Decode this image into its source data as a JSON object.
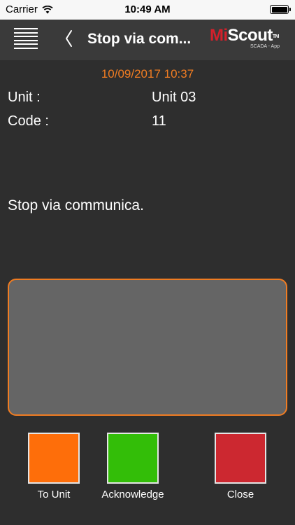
{
  "status_bar": {
    "carrier": "Carrier",
    "time": "10:49 AM",
    "icons": [
      "wifi-icon",
      "battery-icon"
    ]
  },
  "nav": {
    "title": "Stop via com...",
    "logo": {
      "mi": "Mi",
      "scout": "Scout",
      "tm": "TM",
      "subtitle": "SCADA - App"
    },
    "icons": [
      "menu-icon",
      "back-chevron-icon"
    ]
  },
  "alarm": {
    "timestamp": "10/09/2017 10:37",
    "unit_label": "Unit :",
    "unit_value": "Unit 03",
    "code_label": "Code :",
    "code_value": "11",
    "message": "Stop via communica."
  },
  "comment": {
    "value": ""
  },
  "actions": [
    {
      "label": "To Unit",
      "color": "#fe6e0a"
    },
    {
      "label": "Acknowledge",
      "color": "#33be08"
    },
    {
      "label": "Close",
      "color": "#cc2830"
    }
  ],
  "colors": {
    "background": "#2e2e2e",
    "nav_background": "#3a3a3a",
    "accent": "#f07c22",
    "comment_background": "#656565"
  }
}
